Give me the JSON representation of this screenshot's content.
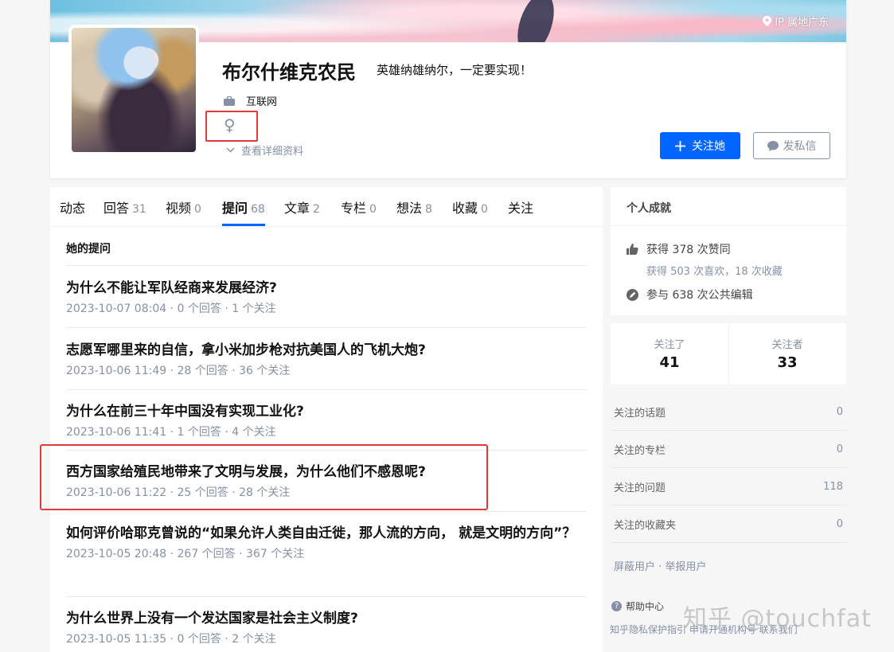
{
  "profile": {
    "ip_location": "IP 属地广东",
    "name": "布尔什维克农民",
    "headline": "英雄纳雄纳尔，一定要实现！",
    "industry": "互联网",
    "gender_symbol": "♀",
    "details_link": "查看详细资料",
    "follow_button": "关注她",
    "message_button": "发私信"
  },
  "tabs": [
    {
      "label": "动态",
      "count": ""
    },
    {
      "label": "回答",
      "count": "31"
    },
    {
      "label": "视频",
      "count": "0"
    },
    {
      "label": "提问",
      "count": "68"
    },
    {
      "label": "文章",
      "count": "2"
    },
    {
      "label": "专栏",
      "count": "0"
    },
    {
      "label": "想法",
      "count": "8"
    },
    {
      "label": "收藏",
      "count": "0"
    },
    {
      "label": "关注",
      "count": ""
    }
  ],
  "section_title": "她的提问",
  "questions": [
    {
      "title": "为什么不能让军队经商来发展经济?",
      "meta": "2023-10-07 08:04 · 0 个回答 · 1 个关注"
    },
    {
      "title": "志愿军哪里来的自信，拿小米加步枪对抗美国人的飞机大炮?",
      "meta": "2023-10-06 11:49 · 28 个回答 · 36 个关注"
    },
    {
      "title": "为什么在前三十年中国没有实现工业化?",
      "meta": "2023-10-06 11:41 · 1 个回答 · 4 个关注"
    },
    {
      "title": "西方国家给殖民地带来了文明与发展，为什么他们不感恩呢?",
      "meta": "2023-10-06 11:22 · 25 个回答 · 28 个关注"
    },
    {
      "title": "如何评价哈耶克曾说的“如果允许人类自由迁徙，那人流的方向， 就是文明的方向”？",
      "meta": "2023-10-05 20:48 · 267 个回答 · 367 个关注"
    },
    {
      "title": "为什么世界上没有一个发达国家是社会主义制度?",
      "meta": "2023-10-05 11:35 · 0 个回答 · 2 个关注"
    }
  ],
  "achievements": {
    "title": "个人成就",
    "likes": "获得 378 次赞同",
    "likes_sub": "获得 503 次喜欢，18 次收藏",
    "edits": "参与 638 次公共编辑"
  },
  "follow": {
    "following_label": "关注了",
    "following_count": "41",
    "followers_label": "关注者",
    "followers_count": "33"
  },
  "stats": [
    {
      "label": "关注的话题",
      "value": "0"
    },
    {
      "label": "关注的专栏",
      "value": "0"
    },
    {
      "label": "关注的问题",
      "value": "118"
    },
    {
      "label": "关注的收藏夹",
      "value": "0"
    }
  ],
  "side_links": "屏蔽用户 · 举报用户",
  "help_center": "帮助中心",
  "footer_links": "知乎隐私保护指引  申请开通机构号  联系我们",
  "watermark": "知乎 @touchfat",
  "colors": {
    "accent": "#0066ff",
    "highlight": "#e03a3a",
    "muted": "#8590a6"
  }
}
